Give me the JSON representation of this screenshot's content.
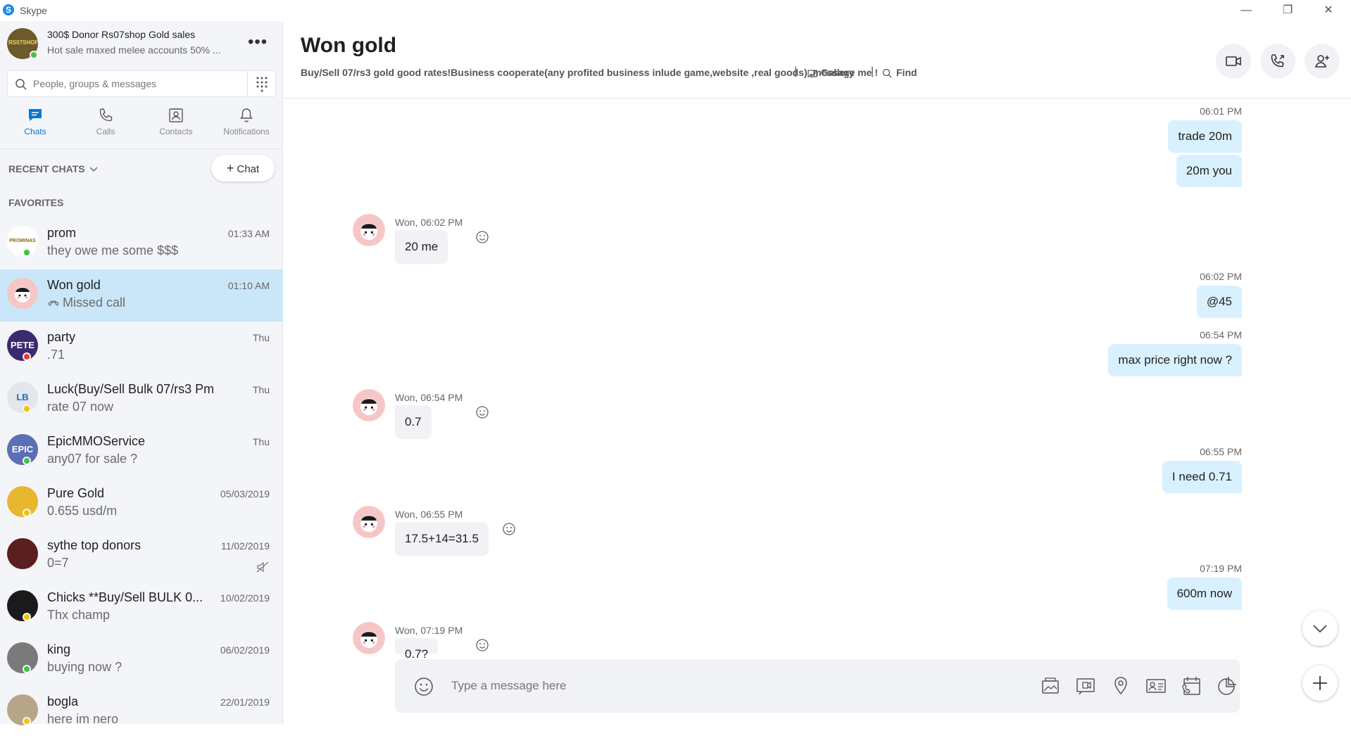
{
  "window": {
    "title": "Skype",
    "minimize": "—",
    "restore": "❐",
    "close": "✕"
  },
  "profile": {
    "name": "300$ Donor Rs07shop  Gold sales",
    "status": "Hot sale maxed melee accounts 50% ...",
    "avatar_text": "RS07SHOP",
    "more": "•••"
  },
  "search": {
    "placeholder": "People, groups & messages"
  },
  "nav": {
    "chats": "Chats",
    "calls": "Calls",
    "contacts": "Contacts",
    "notifications": "Notifications"
  },
  "recent_chats_label": "RECENT CHATS",
  "new_chat_label": "Chat",
  "favorites_label": "FAVORITES",
  "chats": [
    {
      "name": "prom",
      "preview": "they owe me some $$$",
      "time": "01:33 AM",
      "presence": "online",
      "avatar_color": "#ffffff",
      "avatar_text": "PROMINAS"
    },
    {
      "name": "Won gold",
      "preview": "Missed call",
      "time": "01:10 AM",
      "presence": "",
      "avatar_color": "#f6c6c6",
      "avatar_text": ""
    },
    {
      "name": "party",
      "preview": ".71",
      "time": "Thu",
      "presence": "busy",
      "avatar_color": "#3b2a6e",
      "avatar_text": "PETE"
    },
    {
      "name": "Luck(Buy/Sell Bulk 07/rs3 Pm )",
      "preview": "rate 07 now",
      "time": "Thu",
      "presence": "away",
      "avatar_color": "#e3e6ec",
      "avatar_text": "LB"
    },
    {
      "name": "EpicMMOService",
      "preview": "any07 for sale ?",
      "time": "Thu",
      "presence": "online",
      "avatar_color": "#5a6fb5",
      "avatar_text": "EPIC"
    },
    {
      "name": "Pure Gold",
      "preview": "0.655 usd/m",
      "time": "05/03/2019",
      "presence": "away",
      "avatar_color": "#e8b730",
      "avatar_text": ""
    },
    {
      "name": "sythe top donors",
      "preview": "0=7",
      "time": "11/02/2019",
      "presence": "",
      "avatar_color": "#5a1f1f",
      "avatar_text": ""
    },
    {
      "name": "Chicks **Buy/Sell BULK 0...",
      "preview": "Thx champ",
      "time": "10/02/2019",
      "presence": "away",
      "avatar_color": "#1a1a1a",
      "avatar_text": ""
    },
    {
      "name": "king",
      "preview": "buying now ?",
      "time": "06/02/2019",
      "presence": "online",
      "avatar_color": "#7a7a7a",
      "avatar_text": ""
    },
    {
      "name": "bogla",
      "preview": "here im nero",
      "time": "22/01/2019",
      "presence": "away",
      "avatar_color": "#b7a58a",
      "avatar_text": ""
    }
  ],
  "conversation": {
    "title": "Won gold",
    "subtitle": "Buy/Sell 07/rs3 gold good rates!Business cooperate(any profited business inlude game,website ,real goods) ,message me !",
    "separator": "|",
    "gallery_label": "Gallery",
    "find_label": "Find"
  },
  "messages": [
    {
      "dir": "out",
      "time": "06:01 PM",
      "texts": [
        "trade 20m",
        "20m you"
      ]
    },
    {
      "dir": "in",
      "meta": "Won, 06:02 PM",
      "text": "20  me"
    },
    {
      "dir": "out",
      "time": "06:02 PM",
      "texts": [
        "@45"
      ]
    },
    {
      "dir": "out",
      "time": "06:54 PM",
      "texts": [
        "max price right now ?"
      ]
    },
    {
      "dir": "in",
      "meta": "Won, 06:54 PM",
      "text": "0.7"
    },
    {
      "dir": "out",
      "time": "06:55 PM",
      "texts": [
        "I need 0.71"
      ]
    },
    {
      "dir": "in",
      "meta": "Won, 06:55 PM",
      "text": "17.5+14=31.5"
    },
    {
      "dir": "out",
      "time": "07:19 PM",
      "texts": [
        "600m now"
      ]
    },
    {
      "dir": "in",
      "meta": "Won, 07:19 PM",
      "text": "0.7?"
    }
  ],
  "composer": {
    "placeholder": "Type a message here"
  },
  "colors": {
    "accent": "#0078d4",
    "selected": "#c9e7f8",
    "bubble_out": "#d9f1ff",
    "bubble_in": "#f1f2f5"
  }
}
